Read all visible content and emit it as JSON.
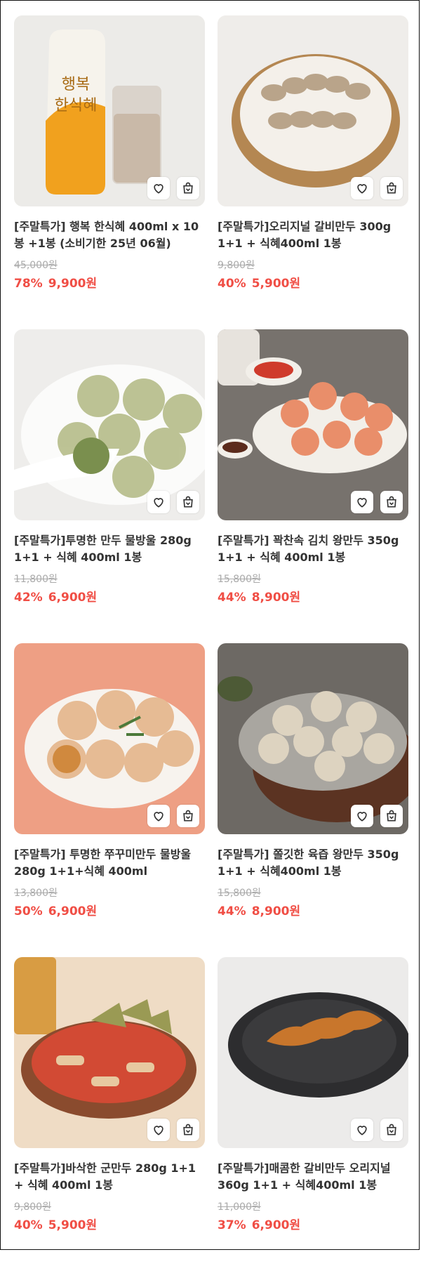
{
  "products": [
    {
      "title": "[주말특가] 행복 한식혜 400ml x 10봉 +1봉 (소비기한 25년 06월)",
      "original_price": "45,000원",
      "discount": "78%",
      "price": "9,900원",
      "image": "sikhye-pouch-and-glass",
      "bg": "#efeeec",
      "accent": "#f1a11e"
    },
    {
      "title": "[주말특가]오리지널 갈비만두 300g 1+1 + 식혜400ml 1봉",
      "original_price": "9,800원",
      "discount": "40%",
      "price": "5,900원",
      "image": "dumplings-in-steamer",
      "bg": "#f1efec",
      "accent": "#b08a5c"
    },
    {
      "title": "[주말특가]투명한 만두 물방울 280g 1+1 + 식혜 400ml 1봉",
      "original_price": "11,800원",
      "discount": "42%",
      "price": "6,900원",
      "image": "clear-dumplings-plate",
      "bg": "#eeeeec",
      "accent": "#a9b58a"
    },
    {
      "title": "[주말특가] 꽉찬속 김치 왕만두 350g 1+1 + 식혜 400ml 1봉",
      "original_price": "15,800원",
      "discount": "44%",
      "price": "8,900원",
      "image": "kimchi-dumplings-plate",
      "bg": "#7b7772",
      "accent": "#e98e6a"
    },
    {
      "title": "[주말특가] 투명한 쭈꾸미만두 물방울 280g 1+1+식혜 400ml",
      "original_price": "13,800원",
      "discount": "50%",
      "price": "6,900원",
      "image": "webfoot-octopus-dumplings",
      "bg": "#ee9f84",
      "accent": "#e3b28a"
    },
    {
      "title": "[주말특가] 쫄깃한 육즙 왕만두 350g 1+1 + 식혜400ml 1봉",
      "original_price": "15,800원",
      "discount": "44%",
      "price": "8,900원",
      "image": "juicy-king-dumplings",
      "bg": "#6e6a66",
      "accent": "#d8cfbd"
    },
    {
      "title": "[주말특가]바삭한 군만두 280g 1+1 + 식혜 400ml 1봉",
      "original_price": "9,800원",
      "discount": "40%",
      "price": "5,900원",
      "image": "fried-dumplings-tteokbokki",
      "bg": "#f0dcc3",
      "accent": "#d2453a"
    },
    {
      "title": "[주말특가]매콤한 갈비만두 오리지널 360g 1+1 + 식혜400ml 1봉",
      "original_price": "11,000원",
      "discount": "37%",
      "price": "6,900원",
      "image": "spicy-dumplings-pan",
      "bg": "#ecebea",
      "accent": "#c7742d"
    }
  ],
  "icons": {
    "wishlist": "heart-icon",
    "cart": "shopping-bag-icon"
  }
}
